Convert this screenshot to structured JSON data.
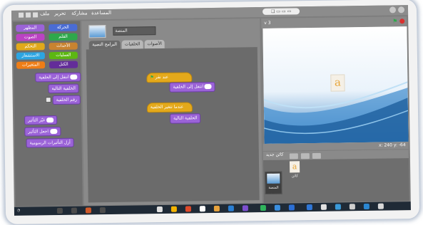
{
  "menu": {
    "items": [
      "المساعدة",
      "مشاركة",
      "تحرير",
      "ملف"
    ]
  },
  "categories": [
    {
      "label": "المظهر",
      "color": "#9b63d8"
    },
    {
      "label": "الحركة",
      "color": "#4a6cd4"
    },
    {
      "label": "الصوت",
      "color": "#bb42c3"
    },
    {
      "label": "القلم",
      "color": "#2ea84b"
    },
    {
      "label": "التحكم",
      "color": "#e1a91a"
    },
    {
      "label": "الأحداث",
      "color": "#c88330"
    },
    {
      "label": "الاستشعار",
      "color": "#2ca5e2"
    },
    {
      "label": "العمليات",
      "color": "#5cb712"
    },
    {
      "label": "المتغيرات",
      "color": "#ee7d16"
    },
    {
      "label": "الكتل",
      "color": "#632d99"
    }
  ],
  "palette_blocks": [
    "انتقل إلى الخلفية",
    "الخلفية التالية",
    "رقم الخلفية",
    "غيّر التأثير",
    "اجعل التأثير",
    "أزل التأثيرات الرسومية"
  ],
  "sprite": {
    "name": "المنصة"
  },
  "tabs": [
    "البرامج النصية",
    "الخلفيات",
    "الأصوات"
  ],
  "scripts": {
    "hat_label": "عند نقر",
    "block1": "انتقل إلى الخلفية",
    "hat2_label": "عندما تتغير الخلفية",
    "block2": "الخلفية التالية"
  },
  "stage": {
    "version": "v 3",
    "sprite_letter": "a",
    "coords": "x: 240  y: -64"
  },
  "sprite_panel": {
    "new_label": "كائن جديد",
    "stage_label": "المنصة",
    "sprite_label": "كائن",
    "sprite_letter": "a"
  },
  "colors": {
    "accent": "#e4a91b",
    "looks": "#9b63d8",
    "stage_bg": "#ffffff"
  }
}
